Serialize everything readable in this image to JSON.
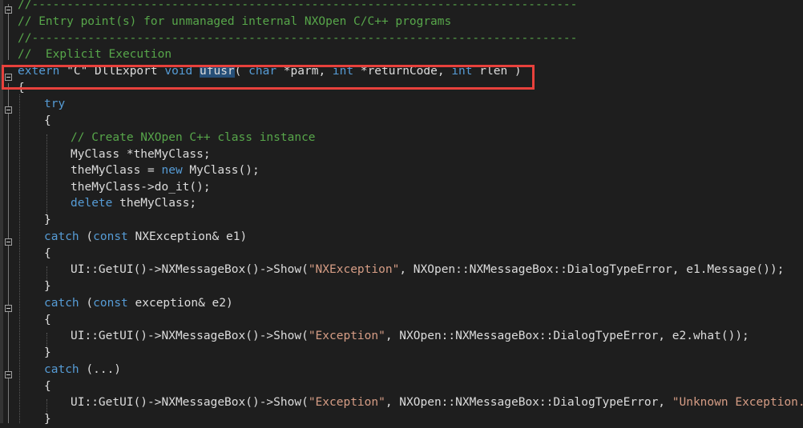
{
  "editor": {
    "accent_highlight": "#e8413c",
    "lines": [
      {
        "parts": [
          {
            "t": "//------------------------------------------------------------------------------",
            "c": "cm"
          }
        ]
      },
      {
        "parts": [
          {
            "t": "// Entry point(s) for unmanaged internal NXOpen C/C++ programs",
            "c": "cm"
          }
        ]
      },
      {
        "parts": [
          {
            "t": "//------------------------------------------------------------------------------",
            "c": "cm"
          }
        ]
      },
      {
        "parts": [
          {
            "t": "//  Explicit Execution",
            "c": "cm"
          }
        ]
      },
      {
        "parts": [
          {
            "t": "extern",
            "c": "kw"
          },
          {
            "t": " \"C\" ",
            "c": "txt"
          },
          {
            "t": "DllExport ",
            "c": "txt"
          },
          {
            "t": "void",
            "c": "kw"
          },
          {
            "t": " ",
            "c": "txt"
          },
          {
            "t": "ufusr",
            "c": "sel"
          },
          {
            "t": "( ",
            "c": "txt"
          },
          {
            "t": "char",
            "c": "kw"
          },
          {
            "t": " *parm, ",
            "c": "txt"
          },
          {
            "t": "int",
            "c": "kw"
          },
          {
            "t": " *returnCode, ",
            "c": "txt"
          },
          {
            "t": "int",
            "c": "kw"
          },
          {
            "t": " rlen )",
            "c": "txt"
          }
        ]
      },
      {
        "parts": [
          {
            "t": "{",
            "c": "txt"
          }
        ]
      },
      {
        "parts": [
          {
            "t": "try",
            "c": "kw"
          }
        ]
      },
      {
        "parts": [
          {
            "t": "{",
            "c": "txt"
          }
        ]
      },
      {
        "parts": [
          {
            "t": "// Create NXOpen C++ class instance",
            "c": "cm"
          }
        ]
      },
      {
        "parts": [
          {
            "t": "MyClass *theMyClass;",
            "c": "txt"
          }
        ]
      },
      {
        "parts": [
          {
            "t": "theMyClass = ",
            "c": "txt"
          },
          {
            "t": "new",
            "c": "kw"
          },
          {
            "t": " MyClass();",
            "c": "txt"
          }
        ]
      },
      {
        "parts": [
          {
            "t": "theMyClass->do_it();",
            "c": "txt"
          }
        ]
      },
      {
        "parts": [
          {
            "t": "delete",
            "c": "kw"
          },
          {
            "t": " theMyClass;",
            "c": "txt"
          }
        ]
      },
      {
        "parts": [
          {
            "t": "}",
            "c": "txt"
          }
        ]
      },
      {
        "parts": [
          {
            "t": "catch",
            "c": "kw"
          },
          {
            "t": " (",
            "c": "txt"
          },
          {
            "t": "const",
            "c": "kw"
          },
          {
            "t": " NXException& e1)",
            "c": "txt"
          }
        ]
      },
      {
        "parts": [
          {
            "t": "{",
            "c": "txt"
          }
        ]
      },
      {
        "parts": [
          {
            "t": "UI::GetUI()->NXMessageBox()->Show(",
            "c": "txt"
          },
          {
            "t": "\"NXException\"",
            "c": "str"
          },
          {
            "t": ", NXOpen::NXMessageBox::DialogTypeError, e1.Message());",
            "c": "txt"
          }
        ]
      },
      {
        "parts": [
          {
            "t": "}",
            "c": "txt"
          }
        ]
      },
      {
        "parts": [
          {
            "t": "catch",
            "c": "kw"
          },
          {
            "t": " (",
            "c": "txt"
          },
          {
            "t": "const",
            "c": "kw"
          },
          {
            "t": " exception& e2)",
            "c": "txt"
          }
        ]
      },
      {
        "parts": [
          {
            "t": "{",
            "c": "txt"
          }
        ]
      },
      {
        "parts": [
          {
            "t": "UI::GetUI()->NXMessageBox()->Show(",
            "c": "txt"
          },
          {
            "t": "\"Exception\"",
            "c": "str"
          },
          {
            "t": ", NXOpen::NXMessageBox::DialogTypeError, e2.what());",
            "c": "txt"
          }
        ]
      },
      {
        "parts": [
          {
            "t": "}",
            "c": "txt"
          }
        ]
      },
      {
        "parts": [
          {
            "t": "catch",
            "c": "kw"
          },
          {
            "t": " (...)",
            "c": "txt"
          }
        ]
      },
      {
        "parts": [
          {
            "t": "{",
            "c": "txt"
          }
        ]
      },
      {
        "parts": [
          {
            "t": "UI::GetUI()->NXMessageBox()->Show(",
            "c": "txt"
          },
          {
            "t": "\"Exception\"",
            "c": "str"
          },
          {
            "t": ", NXOpen::NXMessageBox::DialogTypeError, ",
            "c": "txt"
          },
          {
            "t": "\"Unknown Exception.\"",
            "c": "str"
          },
          {
            "t": ");",
            "c": "txt"
          }
        ]
      },
      {
        "parts": [
          {
            "t": "}",
            "c": "txt"
          }
        ]
      }
    ]
  }
}
